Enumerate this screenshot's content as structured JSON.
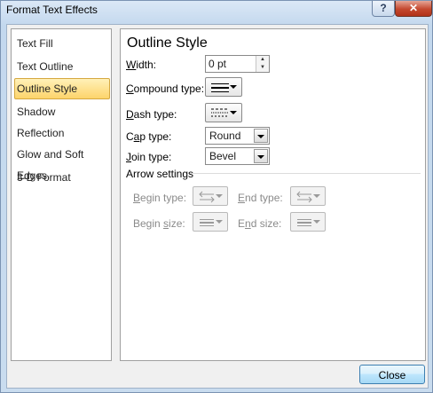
{
  "window": {
    "title": "Format Text Effects",
    "help_glyph": "?",
    "close_glyph": "✕"
  },
  "nav": {
    "items": [
      {
        "label": "Text Fill"
      },
      {
        "label": "Text Outline"
      },
      {
        "label": "Outline Style",
        "selected": true
      },
      {
        "label": "Shadow"
      },
      {
        "label": "Reflection"
      },
      {
        "label": "Glow and Soft Edges"
      },
      {
        "label": "3-D Format"
      }
    ]
  },
  "outline": {
    "heading": "Outline Style",
    "width": {
      "label_accel": "W",
      "label_rest": "idth:",
      "value": "0 pt"
    },
    "compound_type": {
      "label_accel": "C",
      "label_rest": "ompound type:",
      "icon": "compound-lines-icon"
    },
    "dash_type": {
      "label_accel": "D",
      "label_rest": "ash type:",
      "icon": "dash-lines-icon"
    },
    "cap_type": {
      "label_pre": "C",
      "label_accel": "a",
      "label_rest": "p type:",
      "value": "Round"
    },
    "join_type": {
      "label_accel": "J",
      "label_rest": "oin type:",
      "value": "Bevel"
    },
    "arrow_settings": {
      "heading": "Arrow settings",
      "begin_type": {
        "label_accel": "B",
        "label_rest": "egin type:",
        "icon": "arrow-type-icon"
      },
      "end_type": {
        "label_accel": "E",
        "label_rest": "nd type:",
        "icon": "arrow-type-icon"
      },
      "begin_size": {
        "label_pre": "Begin ",
        "label_accel": "s",
        "label_rest": "ize:",
        "icon": "arrow-size-icon"
      },
      "end_size": {
        "label_pre": "E",
        "label_accel": "n",
        "label_rest": "d size:",
        "icon": "arrow-size-icon"
      }
    }
  },
  "footer": {
    "close_label": "Close"
  }
}
